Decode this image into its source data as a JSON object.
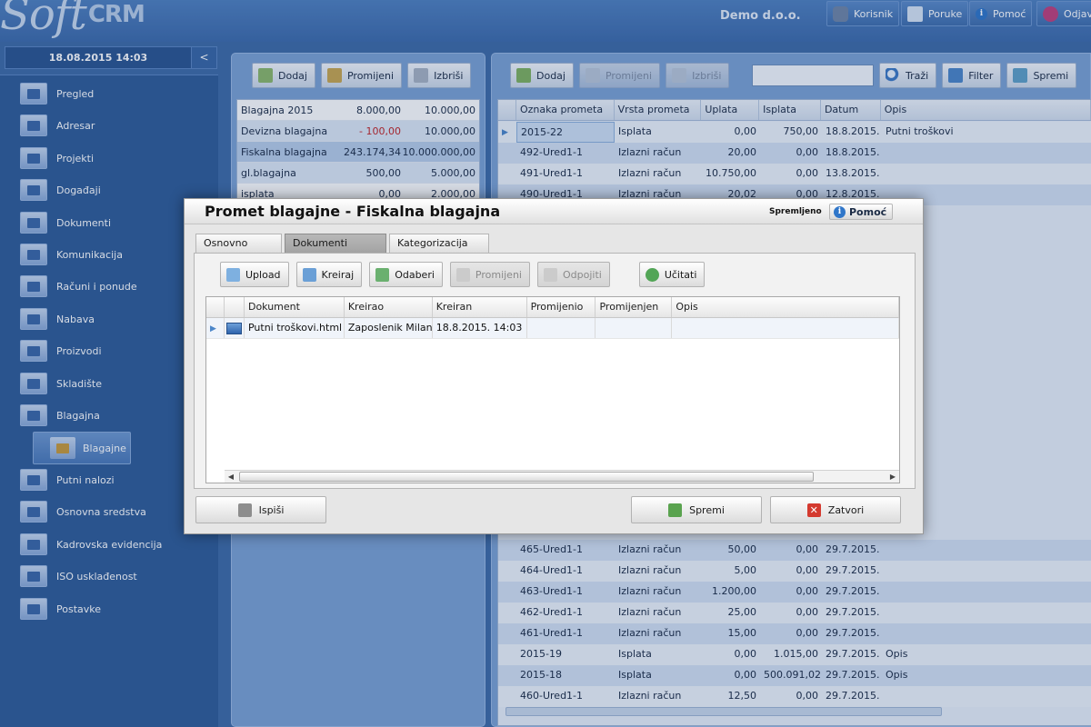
{
  "app": {
    "logo_soft": "Soft",
    "logo_crm": "CRM",
    "company": "Demo d.o.o.",
    "top_nav": [
      {
        "label": "Korisnik",
        "icon": "user-icon",
        "color": "#6f86a6"
      },
      {
        "label": "Poruke",
        "icon": "message-icon",
        "color": "#d7e4f4"
      },
      {
        "label": "Pomoć",
        "icon": "info-icon",
        "color": "#2f76c9"
      },
      {
        "label": "Odjava",
        "icon": "power-icon",
        "color": "#c0407c"
      }
    ]
  },
  "sidebar": {
    "datetime": "18.08.2015 14:03",
    "collapse_label": "<",
    "items": [
      {
        "label": "Pregled"
      },
      {
        "label": "Adresar"
      },
      {
        "label": "Projekti"
      },
      {
        "label": "Događaji"
      },
      {
        "label": "Dokumenti"
      },
      {
        "label": "Komunikacija"
      },
      {
        "label": "Računi i ponude"
      },
      {
        "label": "Nabava"
      },
      {
        "label": "Proizvodi"
      },
      {
        "label": "Skladište"
      },
      {
        "label": "Blagajna"
      },
      {
        "label": "Putni nalozi"
      },
      {
        "label": "Osnovna sredstva"
      },
      {
        "label": "Kadrovska evidencija"
      },
      {
        "label": "ISO usklađenost"
      },
      {
        "label": "Postavke"
      }
    ],
    "sub_item": {
      "label": "Blagajne"
    }
  },
  "left_panel": {
    "toolbar": {
      "add": "Dodaj",
      "edit": "Promijeni",
      "delete": "Izbriši"
    },
    "registers": [
      {
        "name": "Blagajna 2015",
        "balance": "8.000,00",
        "limit": "10.000,00"
      },
      {
        "name": "Devizna blagajna",
        "balance": "- 100,00",
        "limit": "10.000,00"
      },
      {
        "name": "Fiskalna blagajna",
        "balance": "243.174,34",
        "limit": "10.000.000,00"
      },
      {
        "name": "gl.blagajna",
        "balance": "500,00",
        "limit": "5.000,00"
      },
      {
        "name": "isplata",
        "balance": "0,00",
        "limit": "2.000,00"
      }
    ]
  },
  "right_panel": {
    "toolbar": {
      "add": "Dodaj",
      "edit": "Promijeni",
      "delete": "Izbriši",
      "search": "Traži",
      "filter": "Filter",
      "save": "Spremi"
    },
    "search_value": "",
    "columns": [
      "Oznaka prometa",
      "Vrsta prometa",
      "Uplata",
      "Isplata",
      "Datum",
      "Opis"
    ],
    "rows": [
      {
        "oznaka": "2015-22",
        "vrsta": "Isplata",
        "uplata": "0,00",
        "isplata": "750,00",
        "datum": "18.8.2015.",
        "opis": "Putni troškovi"
      },
      {
        "oznaka": "492-Ured1-1",
        "vrsta": "Izlazni račun",
        "uplata": "20,00",
        "isplata": "0,00",
        "datum": "18.8.2015.",
        "opis": ""
      },
      {
        "oznaka": "491-Ured1-1",
        "vrsta": "Izlazni račun",
        "uplata": "10.750,00",
        "isplata": "0,00",
        "datum": "13.8.2015.",
        "opis": ""
      },
      {
        "oznaka": "490-Ured1-1",
        "vrsta": "Izlazni račun",
        "uplata": "20,02",
        "isplata": "0,00",
        "datum": "12.8.2015.",
        "opis": ""
      },
      {
        "oznaka": "465-Ured1-1",
        "vrsta": "Izlazni račun",
        "uplata": "50,00",
        "isplata": "0,00",
        "datum": "29.7.2015.",
        "opis": ""
      },
      {
        "oznaka": "464-Ured1-1",
        "vrsta": "Izlazni račun",
        "uplata": "5,00",
        "isplata": "0,00",
        "datum": "29.7.2015.",
        "opis": ""
      },
      {
        "oznaka": "463-Ured1-1",
        "vrsta": "Izlazni račun",
        "uplata": "1.200,00",
        "isplata": "0,00",
        "datum": "29.7.2015.",
        "opis": ""
      },
      {
        "oznaka": "462-Ured1-1",
        "vrsta": "Izlazni račun",
        "uplata": "25,00",
        "isplata": "0,00",
        "datum": "29.7.2015.",
        "opis": ""
      },
      {
        "oznaka": "461-Ured1-1",
        "vrsta": "Izlazni račun",
        "uplata": "15,00",
        "isplata": "0,00",
        "datum": "29.7.2015.",
        "opis": ""
      },
      {
        "oznaka": "2015-19",
        "vrsta": "Isplata",
        "uplata": "0,00",
        "isplata": "1.015,00",
        "datum": "29.7.2015.",
        "opis": "Opis"
      },
      {
        "oznaka": "2015-18",
        "vrsta": "Isplata",
        "uplata": "0,00",
        "isplata": "500.091,02",
        "datum": "29.7.2015.",
        "opis": "Opis"
      },
      {
        "oznaka": "460-Ured1-1",
        "vrsta": "Izlazni račun",
        "uplata": "12,50",
        "isplata": "0,00",
        "datum": "29.7.2015.",
        "opis": ""
      }
    ]
  },
  "modal": {
    "title": "Promet blagajne - Fiskalna blagajna",
    "status": "Spremljeno",
    "help": "Pomoć",
    "tabs": [
      "Osnovno",
      "Dokumenti",
      "Kategorizacija"
    ],
    "active_tab": "Dokumenti",
    "toolbar": {
      "upload": "Upload",
      "create": "Kreiraj",
      "choose": "Odaberi",
      "edit": "Promijeni",
      "detach": "Odpojiti",
      "load": "Učitati"
    },
    "doc_columns": [
      "Dokument",
      "Kreirao",
      "Kreiran",
      "Promijenio",
      "Promijenjen",
      "Opis"
    ],
    "documents": [
      {
        "name": "Putni troškovi.html",
        "created_by": "Zaposlenik Milan",
        "created": "18.8.2015. 14:03",
        "changed_by": "",
        "changed": "",
        "desc": ""
      }
    ],
    "footer": {
      "print": "Ispiši",
      "save": "Spremi",
      "close": "Zatvori"
    }
  }
}
